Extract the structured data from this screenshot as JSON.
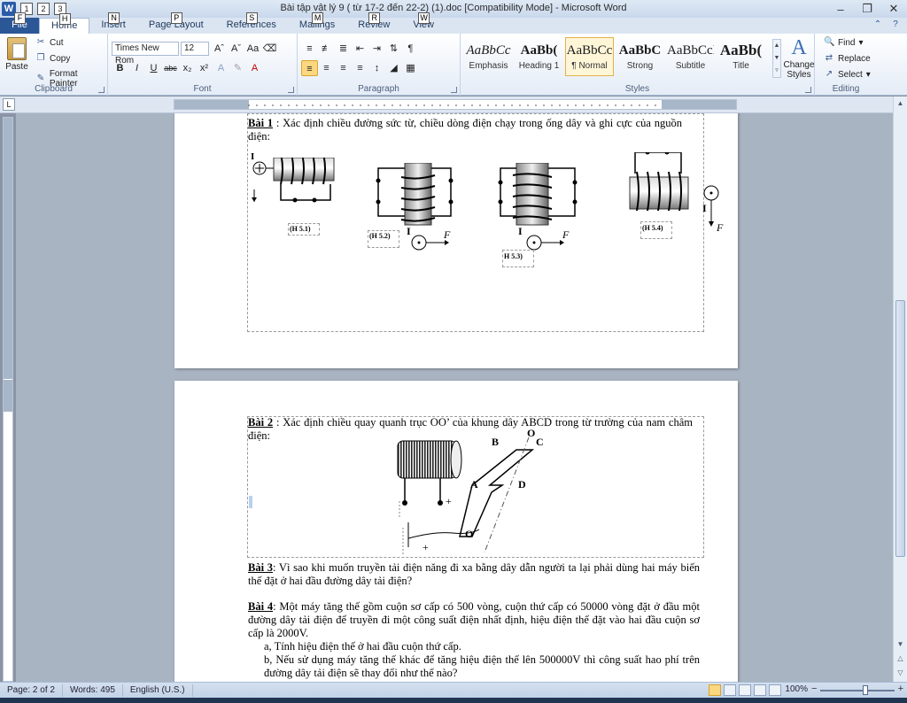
{
  "window": {
    "title": "Bài tập vật lý 9 ( từ 17-2 đến 22-2) (1).doc [Compatibility Mode] - Microsoft Word",
    "app_letter": "W",
    "qat_keytips": [
      "1",
      "2",
      "3"
    ]
  },
  "tabs": [
    {
      "label": "File",
      "key": "F"
    },
    {
      "label": "Home",
      "key": "H"
    },
    {
      "label": "Insert",
      "key": "N"
    },
    {
      "label": "Page Layout",
      "key": "P"
    },
    {
      "label": "References",
      "key": "S"
    },
    {
      "label": "Mailings",
      "key": "M"
    },
    {
      "label": "Review",
      "key": "R"
    },
    {
      "label": "View",
      "key": "W"
    }
  ],
  "ribbon": {
    "clipboard": {
      "label": "Clipboard",
      "paste": "Paste",
      "cut": "Cut",
      "copy": "Copy",
      "format_painter": "Format Painter"
    },
    "font": {
      "label": "Font",
      "family": "Times New Rom",
      "size": "12"
    },
    "paragraph": {
      "label": "Paragraph"
    },
    "styles": {
      "label": "Styles",
      "items": [
        {
          "preview": "AaBbCc",
          "name": "Emphasis",
          "italic": true
        },
        {
          "preview": "AaBb(",
          "name": "Heading 1",
          "bold": true
        },
        {
          "preview": "AaBbCc",
          "name": "¶ Normal"
        },
        {
          "preview": "AaBbC",
          "name": "Strong",
          "bold": true
        },
        {
          "preview": "AaBbCcI",
          "name": "Subtitle"
        },
        {
          "preview": "AaBb(",
          "name": "Title",
          "bold": true
        }
      ],
      "change_styles": "Change Styles"
    },
    "editing": {
      "label": "Editing",
      "find": "Find",
      "replace": "Replace",
      "select": "Select"
    }
  },
  "document": {
    "bai1": {
      "heading": "Bài 1",
      "text": " : Xác định chiều đường sức từ, chiều dòng điện chạy trong ống dây và ghi cực của nguồn điện:",
      "labels": [
        "(H 5.1)",
        "(H 5.2)",
        "H 5.3)",
        "(H 5.4)"
      ]
    },
    "bai2": {
      "heading": "Bài 2",
      "text": " : Xác định chiều quay quanh trục OO’ của khung dây ABCD trong từ trường của nam châm điện:"
    },
    "bai3": {
      "heading": "Bài 3",
      "text": ": Vì sao khi muốn truyền tải điện năng đi xa bằng dây dẫn người ta lại phải dùng hai máy biến thế đặt ở hai đầu đường dây tải điện?"
    },
    "bai4": {
      "heading": "Bài 4",
      "text": ": Một máy tăng thế gồm cuộn sơ cấp có 500 vòng, cuộn thứ cấp có 50000 vòng đặt ở đầu một đường dây tải điện để truyền đi một công suất điện nhất định, hiệu điện thế đặt vào hai đầu cuộn sơ cấp là 2000V.",
      "a": "a, Tính hiệu điện thế ở hai đầu cuộn thứ cấp.",
      "b": "b, Nếu sử dụng máy tăng thế khác để tăng hiệu điện thế lên 500000V thì công suất hao phí trên đường dây tải điện sẽ thay đổi như thế nào?"
    }
  },
  "status": {
    "page": "Page: 2 of 2",
    "words": "Words: 495",
    "language": "English (U.S.)",
    "zoom": "100%"
  }
}
